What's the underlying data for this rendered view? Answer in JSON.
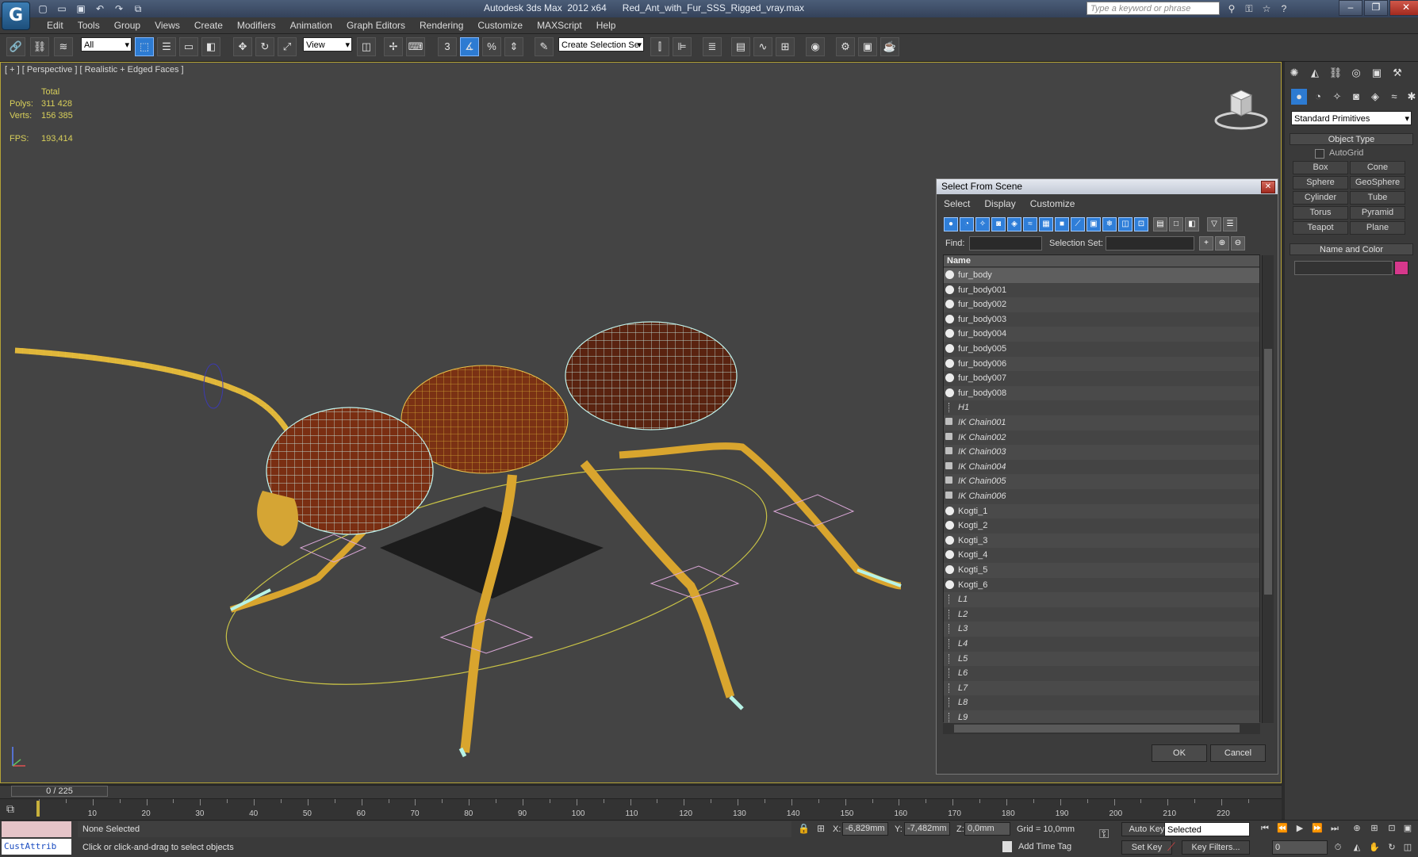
{
  "titlebar": {
    "app_title": "Autodesk 3ds Max  2012 x64",
    "file_name": "Red_Ant_with_Fur_SSS_Rigged_vray.max",
    "search_placeholder": "Type a keyword or phrase",
    "app_logo": "3ds-max-logo",
    "quick_access": [
      "new-icon",
      "open-icon",
      "save-icon",
      "undo-icon",
      "redo-icon",
      "project-icon"
    ],
    "window_controls": [
      "minimize-icon",
      "restore-icon",
      "close-icon"
    ]
  },
  "menu": [
    "Edit",
    "Tools",
    "Group",
    "Views",
    "Create",
    "Modifiers",
    "Animation",
    "Graph Editors",
    "Rendering",
    "Customize",
    "MAXScript",
    "Help"
  ],
  "toolbar": {
    "selection_filter": "All",
    "ref_coord": "View",
    "named_selection": "Create Selection Se",
    "snap_label": "3",
    "angle_snap": "%"
  },
  "viewport": {
    "label": "[ + ] [ Perspective ] [ Realistic + Edged Faces ]",
    "stats_header": "Total",
    "polys_label": "Polys:",
    "polys_value": "311 428",
    "verts_label": "Verts:",
    "verts_value": "156 385",
    "fps_label": "FPS:",
    "fps_value": "193,414"
  },
  "command_panel": {
    "dropdown": "Standard Primitives",
    "object_type_title": "Object Type",
    "autogrid": "AutoGrid",
    "buttons": [
      "Box",
      "Cone",
      "Sphere",
      "GeoSphere",
      "Cylinder",
      "Tube",
      "Torus",
      "Pyramid",
      "Teapot",
      "Plane"
    ],
    "name_color_title": "Name and Color",
    "color_swatch": "#d6388c"
  },
  "dialog": {
    "title": "Select From Scene",
    "menu": [
      "Select",
      "Display",
      "Customize"
    ],
    "find_label": "Find:",
    "selection_set_label": "Selection Set:",
    "column_name": "Name",
    "rows": [
      {
        "name": "fur_body",
        "kind": "geo",
        "style": "normal"
      },
      {
        "name": "fur_body001",
        "kind": "geo",
        "style": "normal"
      },
      {
        "name": "fur_body002",
        "kind": "geo",
        "style": "normal"
      },
      {
        "name": "fur_body003",
        "kind": "geo",
        "style": "normal"
      },
      {
        "name": "fur_body004",
        "kind": "geo",
        "style": "normal"
      },
      {
        "name": "fur_body005",
        "kind": "geo",
        "style": "normal"
      },
      {
        "name": "fur_body006",
        "kind": "geo",
        "style": "normal"
      },
      {
        "name": "fur_body007",
        "kind": "geo",
        "style": "normal"
      },
      {
        "name": "fur_body008",
        "kind": "geo",
        "style": "normal"
      },
      {
        "name": "H1",
        "kind": "bone",
        "style": "italic"
      },
      {
        "name": "IK Chain001",
        "kind": "ik",
        "style": "italic"
      },
      {
        "name": "IK Chain002",
        "kind": "ik",
        "style": "italic"
      },
      {
        "name": "IK Chain003",
        "kind": "ik",
        "style": "italic"
      },
      {
        "name": "IK Chain004",
        "kind": "ik",
        "style": "italic"
      },
      {
        "name": "IK Chain005",
        "kind": "ik",
        "style": "italic"
      },
      {
        "name": "IK Chain006",
        "kind": "ik",
        "style": "italic"
      },
      {
        "name": "Kogti_1",
        "kind": "geo",
        "style": "normal"
      },
      {
        "name": "Kogti_2",
        "kind": "geo",
        "style": "normal"
      },
      {
        "name": "Kogti_3",
        "kind": "geo",
        "style": "normal"
      },
      {
        "name": "Kogti_4",
        "kind": "geo",
        "style": "normal"
      },
      {
        "name": "Kogti_5",
        "kind": "geo",
        "style": "normal"
      },
      {
        "name": "Kogti_6",
        "kind": "geo",
        "style": "normal"
      },
      {
        "name": "L1",
        "kind": "bone",
        "style": "italic"
      },
      {
        "name": "L2",
        "kind": "bone",
        "style": "italic"
      },
      {
        "name": "L3",
        "kind": "bone",
        "style": "italic"
      },
      {
        "name": "L4",
        "kind": "bone",
        "style": "italic"
      },
      {
        "name": "L5",
        "kind": "bone",
        "style": "italic"
      },
      {
        "name": "L6",
        "kind": "bone",
        "style": "italic"
      },
      {
        "name": "L7",
        "kind": "bone",
        "style": "italic"
      },
      {
        "name": "L8",
        "kind": "bone",
        "style": "italic"
      },
      {
        "name": "L9",
        "kind": "bone",
        "style": "italic"
      }
    ],
    "ok": "OK",
    "cancel": "Cancel"
  },
  "timeline": {
    "slider": "0 / 225",
    "ticks": [
      "10",
      "20",
      "30",
      "40",
      "50",
      "60",
      "70",
      "80",
      "90",
      "100",
      "110",
      "120",
      "130",
      "140",
      "150",
      "160",
      "170",
      "180",
      "190",
      "200",
      "210",
      "220"
    ]
  },
  "status": {
    "maxscript_label": "CustAttrib",
    "selection": "None Selected",
    "prompt": "Click or click-and-drag to select objects",
    "x_label": "X:",
    "x_value": "-6,829mm",
    "y_label": "Y:",
    "y_value": "-7,482mm",
    "z_label": "Z:",
    "z_value": "0,0mm",
    "grid": "Grid = 10,0mm",
    "add_time_tag": "Add Time Tag",
    "auto_key": "Auto Key",
    "auto_key_mode": "Selected",
    "set_key": "Set Key",
    "key_filters": "Key Filters...",
    "current_frame": "0"
  }
}
